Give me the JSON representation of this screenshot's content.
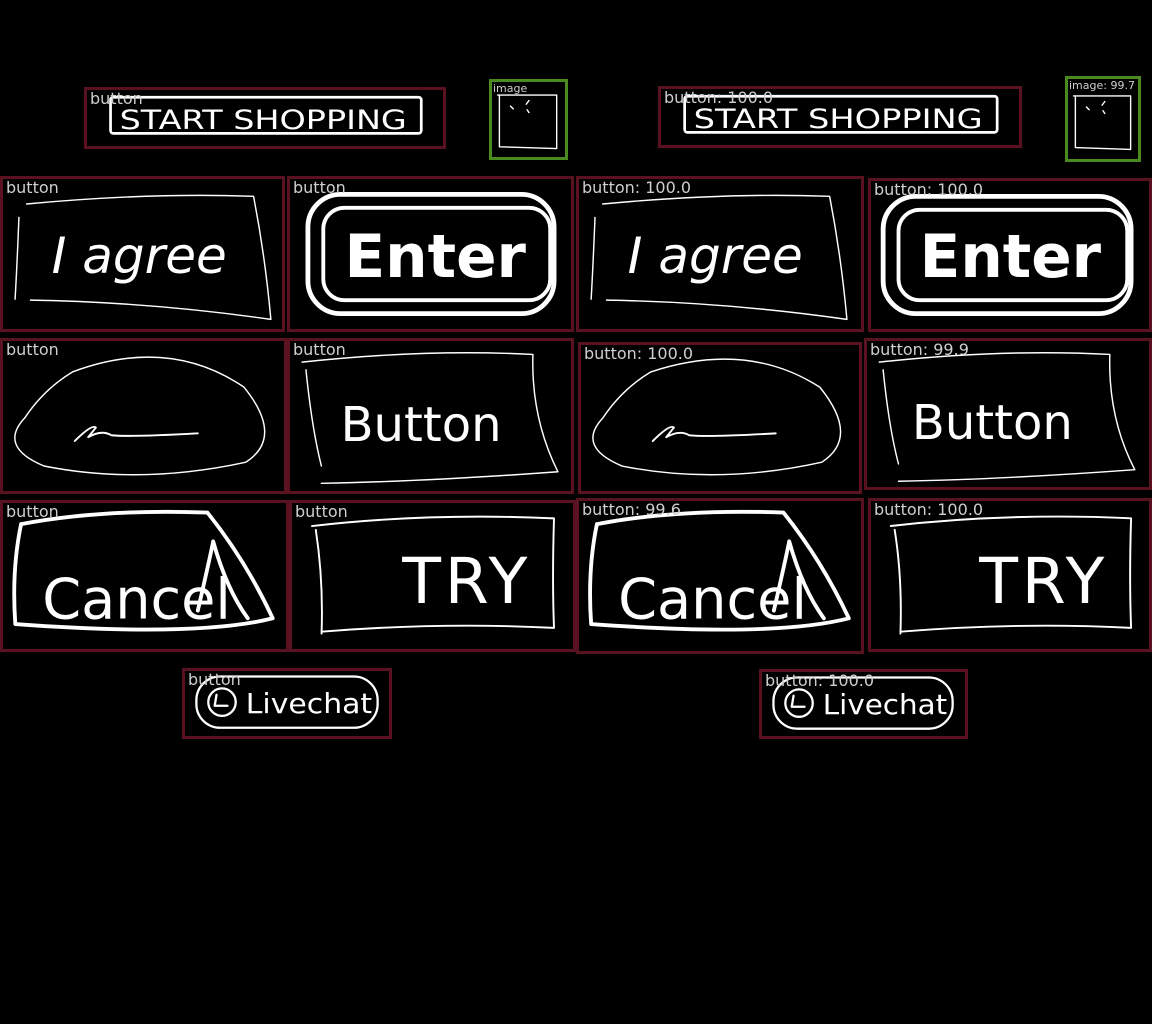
{
  "panels": [
    {
      "id": "left",
      "items": [
        {
          "key": "start_shopping",
          "kind": "button",
          "tag": "button",
          "text": "START SHOPPING"
        },
        {
          "key": "image",
          "kind": "image",
          "tag": "image"
        },
        {
          "key": "i_agree",
          "kind": "button",
          "tag": "button",
          "text": "I agree"
        },
        {
          "key": "enter",
          "kind": "button",
          "tag": "button",
          "text": "Enter"
        },
        {
          "key": "scribble",
          "kind": "button",
          "tag": "button"
        },
        {
          "key": "button",
          "kind": "button",
          "tag": "button",
          "text": "Button"
        },
        {
          "key": "cancel",
          "kind": "button",
          "tag": "button",
          "text": "Cancel"
        },
        {
          "key": "try",
          "kind": "button",
          "tag": "button",
          "text": "TRY"
        },
        {
          "key": "livechat",
          "kind": "button",
          "tag": "button",
          "text": "Livechat"
        }
      ]
    },
    {
      "id": "right",
      "items": [
        {
          "key": "start_shopping",
          "kind": "button",
          "tag": "button: 100.0",
          "text": "START SHOPPING"
        },
        {
          "key": "image",
          "kind": "image",
          "tag": "image: 99.7"
        },
        {
          "key": "i_agree",
          "kind": "button",
          "tag": "button: 100.0",
          "text": "I agree"
        },
        {
          "key": "enter",
          "kind": "button",
          "tag": "button: 100.0",
          "text": "Enter"
        },
        {
          "key": "scribble",
          "kind": "button",
          "tag": "button: 100.0"
        },
        {
          "key": "button",
          "kind": "button",
          "tag": "button: 99.9",
          "text": "Button"
        },
        {
          "key": "cancel",
          "kind": "button",
          "tag": "button: 99.6",
          "text": "Cancel"
        },
        {
          "key": "try",
          "kind": "button",
          "tag": "button: 100.0",
          "text": "TRY"
        },
        {
          "key": "livechat",
          "kind": "button",
          "tag": "button: 100.0",
          "text": "Livechat"
        }
      ]
    }
  ],
  "colors": {
    "button_box": "#5a1220",
    "image_box": "#4a8a1e",
    "label": "#cfcfcf",
    "sketch": "#ffffff",
    "background": "#000000"
  }
}
